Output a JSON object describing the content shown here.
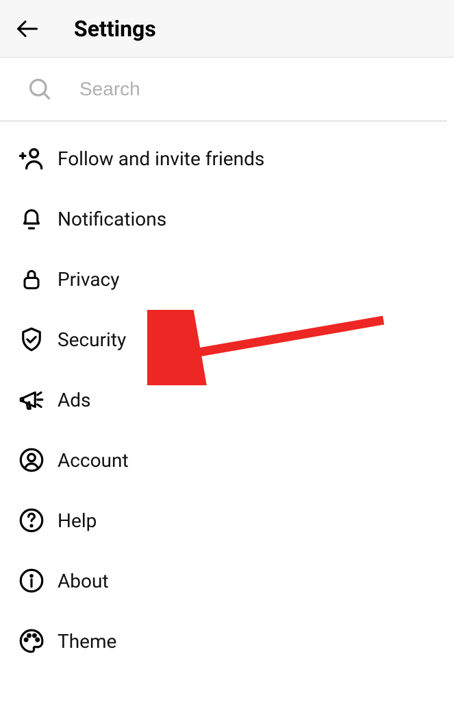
{
  "header": {
    "title": "Settings"
  },
  "search": {
    "placeholder": "Search"
  },
  "menu": {
    "items": [
      {
        "label": "Follow and invite friends",
        "icon": "add-user-icon"
      },
      {
        "label": "Notifications",
        "icon": "bell-icon"
      },
      {
        "label": "Privacy",
        "icon": "lock-icon"
      },
      {
        "label": "Security",
        "icon": "shield-check-icon"
      },
      {
        "label": "Ads",
        "icon": "megaphone-icon"
      },
      {
        "label": "Account",
        "icon": "person-circle-icon"
      },
      {
        "label": "Help",
        "icon": "question-circle-icon"
      },
      {
        "label": "About",
        "icon": "info-circle-icon"
      },
      {
        "label": "Theme",
        "icon": "palette-icon"
      }
    ]
  },
  "annotation": {
    "arrow_color": "#ed2724",
    "points_to": "Security"
  }
}
